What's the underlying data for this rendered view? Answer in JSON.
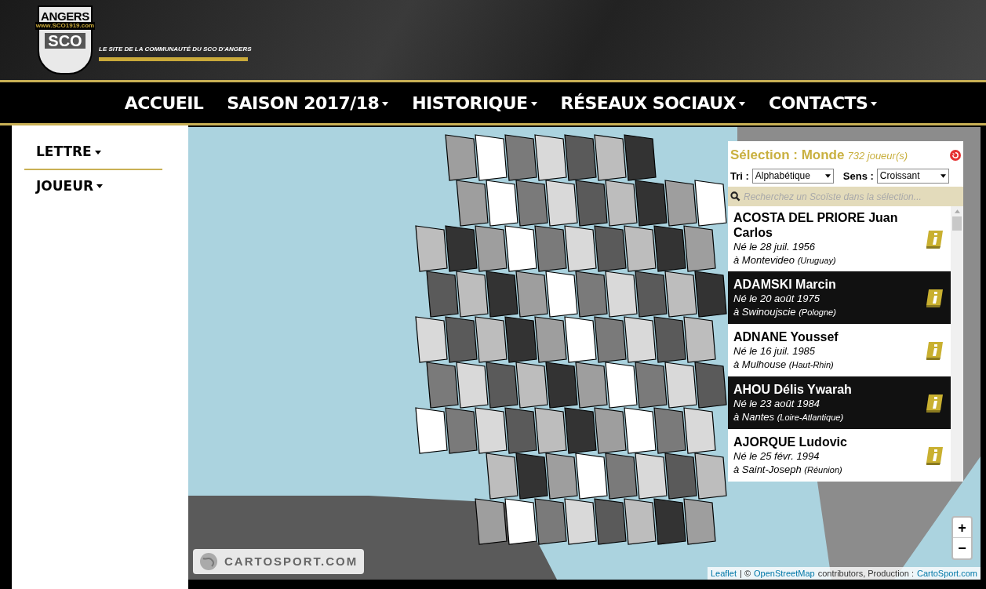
{
  "header": {
    "logo_top": "ANGERS",
    "logo_url": "www.SCO1919.com",
    "logo_bottom": "SCO",
    "tagline": "LE SITE DE LA COMMUNAUTÉ DU SCO D'ANGERS"
  },
  "nav": [
    {
      "label": "ACCUEIL",
      "dropdown": false
    },
    {
      "label": "SAISON 2017/18",
      "dropdown": true
    },
    {
      "label": "HISTORIQUE",
      "dropdown": true
    },
    {
      "label": "RÉSEAUX SOCIAUX",
      "dropdown": true
    },
    {
      "label": "CONTACTS",
      "dropdown": true
    }
  ],
  "sidebar": {
    "items": [
      {
        "label": "LETTRE"
      },
      {
        "label": "JOUEUR"
      }
    ]
  },
  "panel": {
    "title": "Sélection : Monde",
    "count": "732 joueur(s)",
    "sort_label": "Tri :",
    "sort_value": "Alphabétique",
    "order_label": "Sens :",
    "order_value": "Croissant",
    "search": {
      "placeholder": "Recherchez un Scoïste dans la sélection..."
    },
    "players": [
      {
        "name": "ACOSTA DEL PRIORE Juan Carlos",
        "born": "Né le 28 juil. 1956",
        "place": "à Montevideo",
        "region": "(Uruguay)",
        "highlighted": false
      },
      {
        "name": "ADAMSKI Marcin",
        "born": "Né le 20 août 1975",
        "place": "à Swinoujscie",
        "region": "(Pologne)",
        "highlighted": true
      },
      {
        "name": "ADNANE Youssef",
        "born": "Né le 16 juil. 1985",
        "place": "à Mulhouse",
        "region": "(Haut-Rhin)",
        "highlighted": false
      },
      {
        "name": "AHOU Délis Ywarah",
        "born": "Né le 23 août 1984",
        "place": "à Nantes",
        "region": "(Loire-Atlantique)",
        "highlighted": true
      },
      {
        "name": "AJORQUE Ludovic",
        "born": "Né le 25 févr. 1994",
        "place": "à Saint-Joseph",
        "region": "(Réunion)",
        "highlighted": false
      }
    ]
  },
  "map": {
    "brand": "CARTOSPORT.COM",
    "zoom_in": "+",
    "zoom_out": "−",
    "attribution": {
      "leaflet": "Leaflet",
      "sep": "| ©",
      "osm": "OpenStreetMap",
      "text": "contributors, Production :",
      "cartosport": "CartoSport.com"
    }
  }
}
